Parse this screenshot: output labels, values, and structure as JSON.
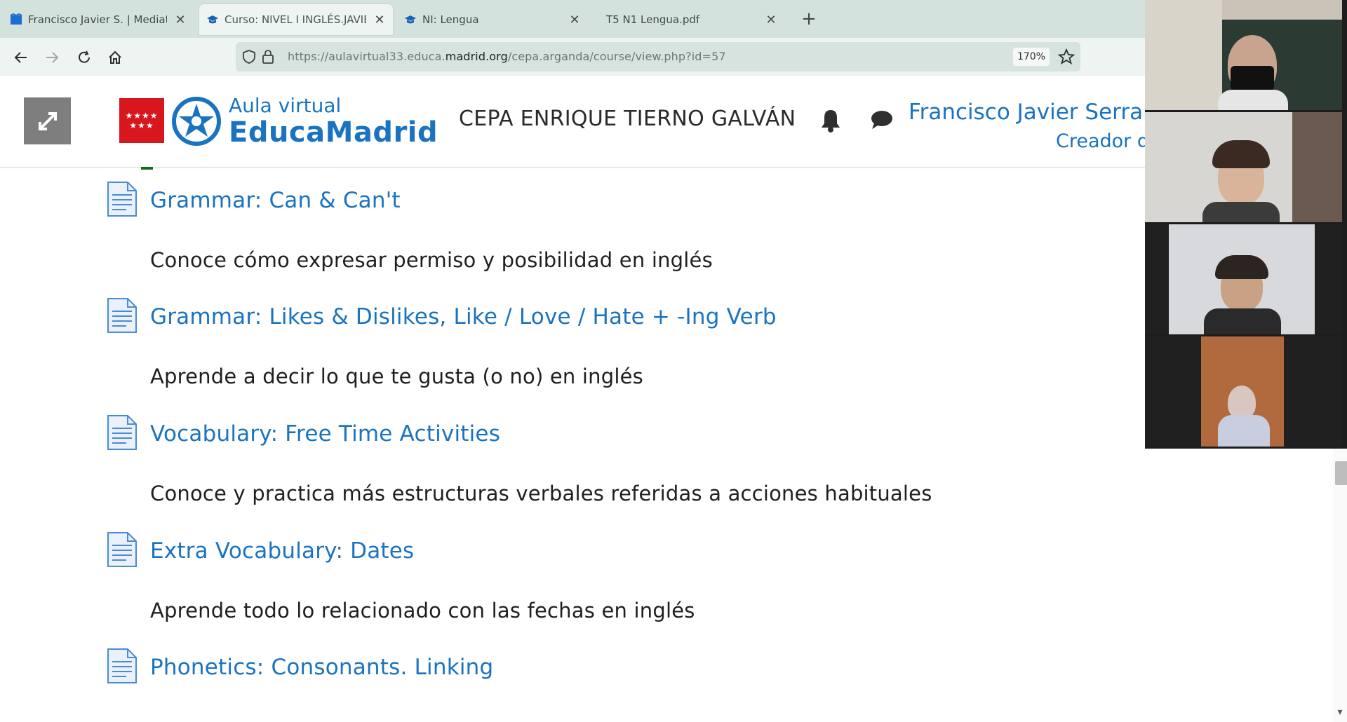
{
  "browser": {
    "tabs": [
      {
        "title": "Francisco Javier S. | Mediateca"
      },
      {
        "title": "Curso: NIVEL I INGLÉS.JAVIER"
      },
      {
        "title": "NI: Lengua"
      },
      {
        "title": "T5 N1 Lengua.pdf"
      }
    ],
    "url_prefix": "https://aulavirtual33.educa.",
    "url_domain": "madrid.org",
    "url_path": "/cepa.arganda/course/view.php?id=57",
    "zoom": "170%"
  },
  "header": {
    "logo_line1": "Aula virtual",
    "logo_line2": "EducaMadrid",
    "school": "CEPA ENRIQUE TIERNO GALVÁN",
    "user_name": "Francisco Javier Serranc",
    "user_role": "Creador d"
  },
  "activities": [
    {
      "title": "Grammar: Can & Can't",
      "description": "Conoce cómo expresar permiso y posibilidad en inglés",
      "completed": false
    },
    {
      "title": "Grammar: Likes & Dislikes, Like / Love / Hate + -Ing Verb",
      "description": "Aprende a decir lo que te gusta (o no) en inglés",
      "completed": false
    },
    {
      "title": "Vocabulary: Free Time Activities",
      "description": "Conoce y practica más estructuras verbales referidas a acciones habituales",
      "completed": false
    },
    {
      "title": "Extra Vocabulary: Dates",
      "description": "Aprende todo lo relacionado con las fechas en inglés",
      "completed": true
    },
    {
      "title": "Phonetics: Consonants. Linking",
      "description": "",
      "completed": true
    }
  ],
  "colors": {
    "link": "#1a73c0",
    "madrid_red": "#d7161d",
    "tabbar": "#d3e2dc"
  }
}
